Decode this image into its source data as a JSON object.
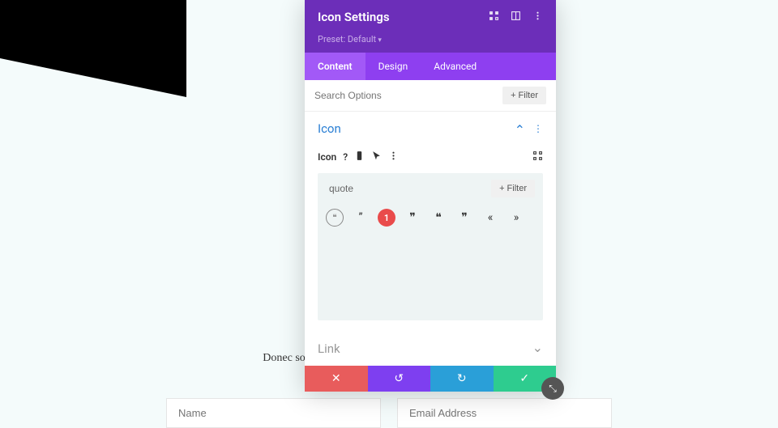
{
  "page": {
    "body_text": "Donec sollicitudin molestie                                                                             esque nec, egestas non nisi.",
    "form": {
      "name_placeholder": "Name",
      "email_placeholder": "Email Address"
    }
  },
  "panel": {
    "title": "Icon Settings",
    "preset_label": "Preset:",
    "preset_value": "Default",
    "tabs": {
      "content": "Content",
      "design": "Design",
      "advanced": "Advanced"
    },
    "search_placeholder": "Search Options",
    "filter_label": "Filter",
    "sections": {
      "icon": {
        "title": "Icon",
        "field_label": "Icon",
        "icon_search_value": "quote",
        "annotation": "1"
      },
      "link": {
        "title": "Link"
      }
    }
  }
}
